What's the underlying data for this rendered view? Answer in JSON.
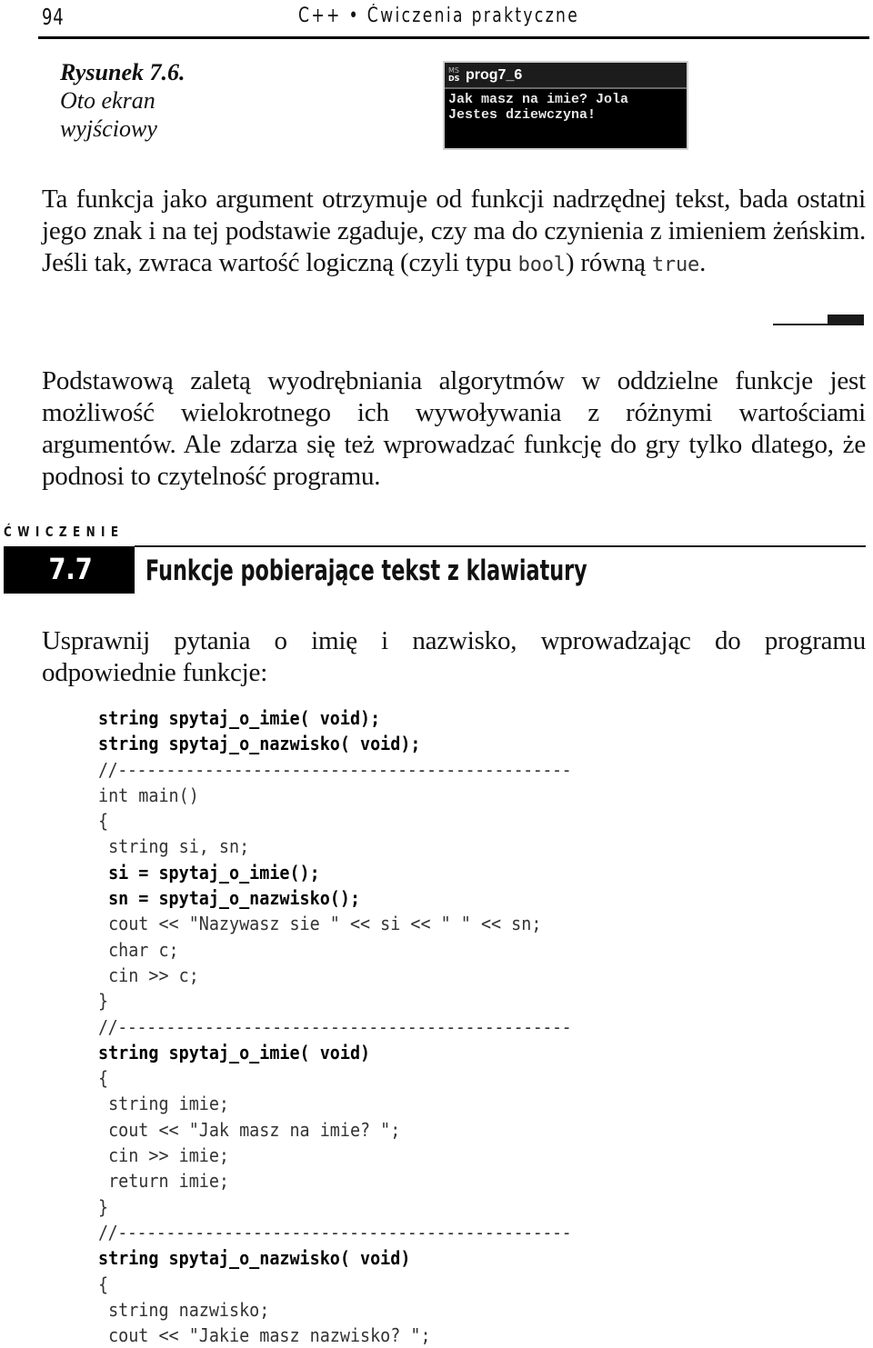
{
  "header": {
    "page_number": "94",
    "running_title": "C++ • Ćwiczenia praktyczne"
  },
  "figure": {
    "caption_title": "Rysunek 7.6.",
    "caption_lines": [
      "Oto ekran",
      "wyjściowy"
    ],
    "console": {
      "icon": "msdos-icon",
      "icon_text_top": "MS",
      "icon_text_bottom": "DS",
      "title": "prog7_6",
      "output_lines": [
        "Jak masz na imie? Jola",
        "Jestes dziewczyna!"
      ]
    }
  },
  "paragraphs": {
    "p1": {
      "before_bool": "Ta funkcja jako argument otrzymuje od funkcji nadrzędnej tekst, bada ostatni jego znak i na tej podstawie zgaduje, czy ma do czynienia z imieniem żeńskim. Jeśli tak, zwraca wartość logiczną (czyli typu ",
      "code_bool": "bool",
      "between": ") równą ",
      "code_true": "true",
      "after": "."
    },
    "p2": "Podstawową zaletą wyodrębniania algorytmów w oddzielne funkcje jest możliwość wielokrotnego ich wywoływania z różnymi wartościami argumentów. Ale zdarza się też wprowadzać funkcję do gry tylko dlatego, że podnosi to czytelność programu.",
    "p3": "Usprawnij pytania o imię i nazwisko, wprowadzając do programu odpowiednie funkcje:"
  },
  "exercise": {
    "label": "ĆWICZENIE",
    "number": "7.7",
    "title": "Funkcje pobierające tekst z klawiatury"
  },
  "code_lines": [
    {
      "text": "string spytaj_o_imie( void);",
      "style": "bold"
    },
    {
      "text": "string spytaj_o_nazwisko( void);",
      "style": "bold"
    },
    {
      "text": "//-----------------------------------------------",
      "style": "comment"
    },
    {
      "text": "int main()",
      "style": "light"
    },
    {
      "text": "{",
      "style": "light"
    },
    {
      "text": " string si, sn;",
      "style": "light"
    },
    {
      "text": " si = spytaj_o_imie();",
      "style": "bold"
    },
    {
      "text": " sn = spytaj_o_nazwisko();",
      "style": "bold"
    },
    {
      "text": " cout << \"Nazywasz sie \" << si << \" \" << sn;",
      "style": "light"
    },
    {
      "text": " char c;",
      "style": "light"
    },
    {
      "text": " cin >> c;",
      "style": "light"
    },
    {
      "text": "}",
      "style": "light"
    },
    {
      "text": "//-----------------------------------------------",
      "style": "comment"
    },
    {
      "text": "string spytaj_o_imie( void)",
      "style": "bold"
    },
    {
      "text": "{",
      "style": "light"
    },
    {
      "text": " string imie;",
      "style": "light"
    },
    {
      "text": " cout << \"Jak masz na imie? \";",
      "style": "light"
    },
    {
      "text": " cin >> imie;",
      "style": "light"
    },
    {
      "text": " return imie;",
      "style": "light"
    },
    {
      "text": "}",
      "style": "light"
    },
    {
      "text": "//-----------------------------------------------",
      "style": "comment"
    },
    {
      "text": "string spytaj_o_nazwisko( void)",
      "style": "bold"
    },
    {
      "text": "{",
      "style": "light"
    },
    {
      "text": " string nazwisko;",
      "style": "light"
    },
    {
      "text": " cout << \"Jakie masz nazwisko? \";",
      "style": "light"
    }
  ]
}
